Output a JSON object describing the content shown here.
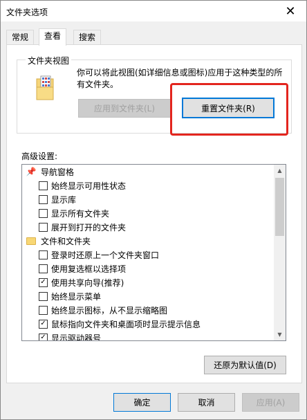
{
  "window": {
    "title": "文件夹选项",
    "close_glyph": "✕"
  },
  "tabs": [
    {
      "label": "常规"
    },
    {
      "label": "查看"
    },
    {
      "label": "搜索"
    }
  ],
  "folder_views": {
    "title": "文件夹视图",
    "description": "你可以将此视图(如详细信息或图标)应用于这种类型的所有文件夹。",
    "apply_button": "应用到文件夹(L)",
    "reset_button": "重置文件夹(R)"
  },
  "advanced": {
    "label": "高级设置:",
    "items": [
      {
        "label": "导航窗格",
        "type": "category",
        "icon": "pin-icon"
      },
      {
        "label": "始终显示可用性状态",
        "type": "checkbox",
        "checked": false
      },
      {
        "label": "显示库",
        "type": "checkbox",
        "checked": false
      },
      {
        "label": "显示所有文件夹",
        "type": "checkbox",
        "checked": false
      },
      {
        "label": "展开到打开的文件夹",
        "type": "checkbox",
        "checked": false
      },
      {
        "label": "文件和文件夹",
        "type": "category",
        "icon": "folder-icon"
      },
      {
        "label": "登录时还原上一个文件夹窗口",
        "type": "checkbox",
        "checked": false
      },
      {
        "label": "使用复选框以选择项",
        "type": "checkbox",
        "checked": false
      },
      {
        "label": "使用共享向导(推荐)",
        "type": "checkbox",
        "checked": true
      },
      {
        "label": "始终显示菜单",
        "type": "checkbox",
        "checked": false
      },
      {
        "label": "始终显示图标，从不显示缩略图",
        "type": "checkbox",
        "checked": false
      },
      {
        "label": "鼠标指向文件夹和桌面项时显示提示信息",
        "type": "checkbox",
        "checked": true
      },
      {
        "label": "显示驱动器号",
        "type": "checkbox",
        "checked": true
      }
    ],
    "restore_button": "还原为默认值(D)"
  },
  "footer": {
    "ok": "确定",
    "cancel": "取消",
    "apply": "应用(A)"
  },
  "colors": {
    "highlight": "#e3251e",
    "focus": "#0078d7"
  }
}
